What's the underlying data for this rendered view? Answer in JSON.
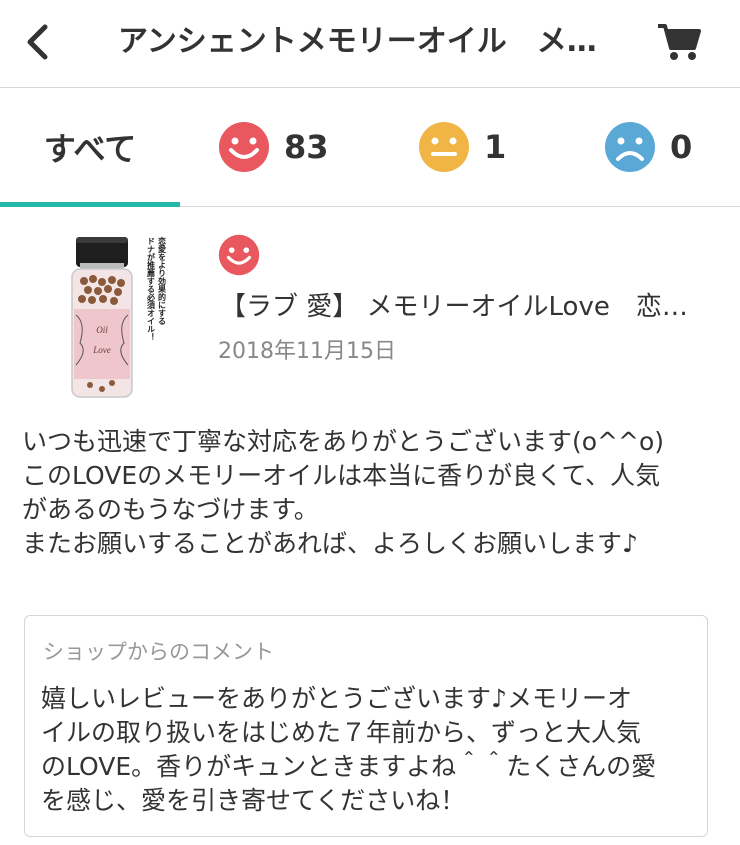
{
  "header": {
    "title": "アンシェントメモリーオイル　メ…",
    "back_icon": "chevron-left-icon",
    "cart_icon": "cart-icon"
  },
  "tabs": {
    "all_label": "すべて",
    "good_count": "83",
    "normal_count": "1",
    "bad_count": "0",
    "colors": {
      "good": "#e9585f",
      "normal": "#f0b545",
      "bad": "#5aa8d6",
      "indicator": "#26b7ac"
    }
  },
  "review": {
    "rating_icon": "smile-face-icon",
    "product_name": "【ラブ 愛】 メモリーオイルLove　恋愛をより効果的にするドナが推薦する必須オイル！",
    "date": "2018年11月15日",
    "body": "いつも迅速で丁寧な対応をありがとうございます(o^^o)\nこのLOVEのメモリーオイルは本当に香りが良くて、人気\nがあるのもうなづけます。\nまたお願いすることがあれば、よろしくお願いします♪",
    "product_image": {
      "label_line1": "Oil",
      "label_line2": "Love",
      "caption_col1": "恋愛をより効果的にする",
      "caption_col2": "ドナが推薦する必須オイル！"
    }
  },
  "shop_comment": {
    "label": "ショップからのコメント",
    "text": "嬉しいレビューをありがとうございます♪メモリーオ\nイルの取り扱いをはじめた７年前から、ずっと大人気\nのLOVE。香りがキュンときますよね＾＾たくさんの愛\nを感じ、愛を引き寄せてくださいね！"
  }
}
